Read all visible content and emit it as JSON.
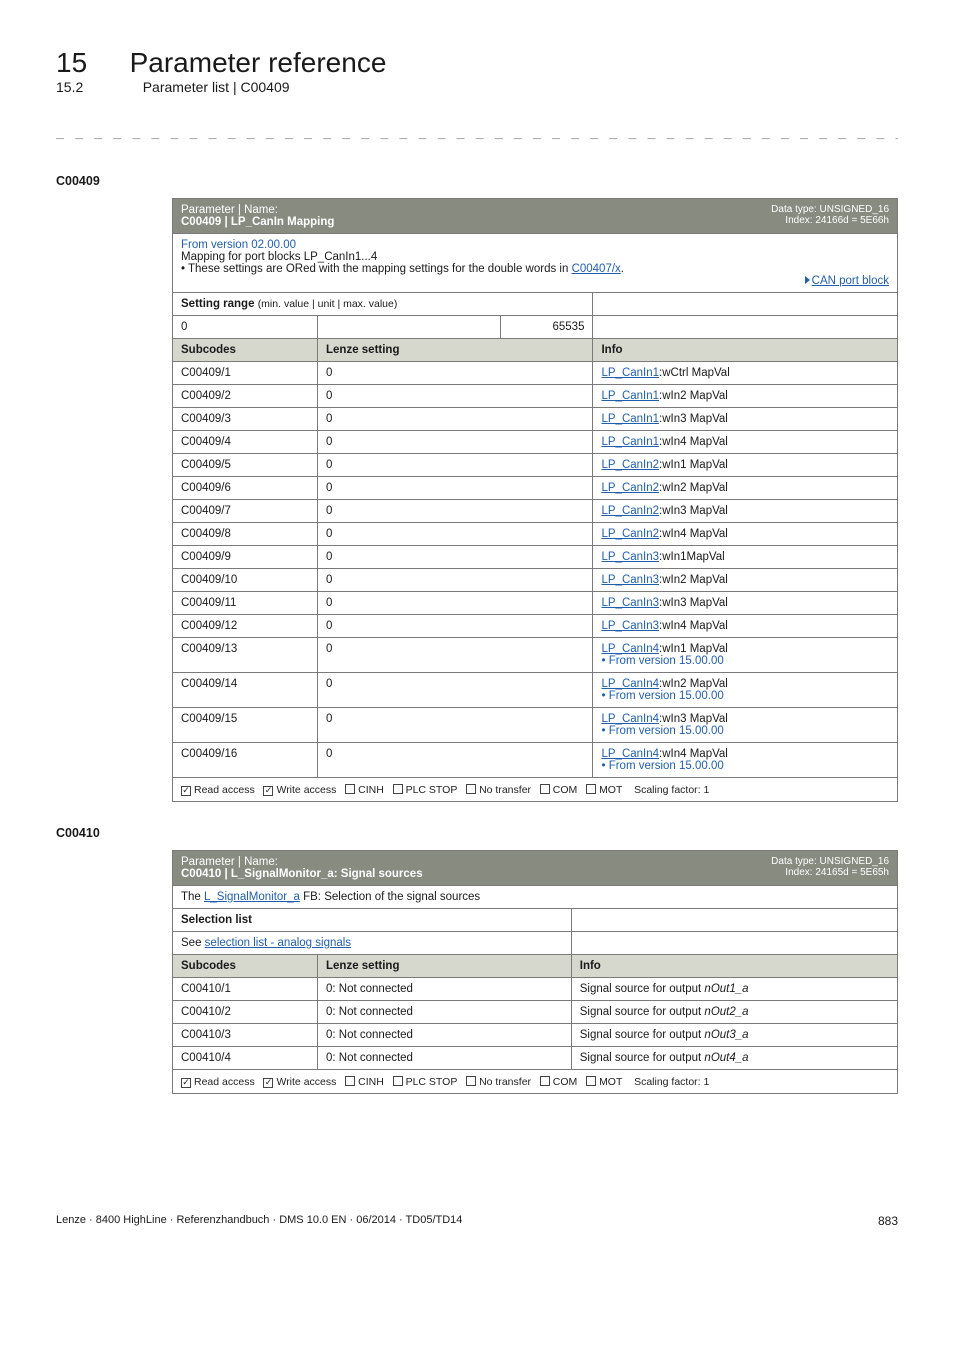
{
  "chapter": {
    "num": "15",
    "title": "Parameter reference",
    "sub_num": "15.2",
    "sub_title": "Parameter list | C00409"
  },
  "dash_sep": "_ _ _ _ _ _ _ _ _ _ _ _ _ _ _ _ _ _ _ _ _ _ _ _ _ _ _ _ _ _ _ _ _ _ _ _ _ _ _ _ _ _ _ _ _ _ _ _ _ _ _ _ _ _ _ _ _ _ _ _ _ _ _ _",
  "c00409": {
    "heading": "C00409",
    "header": {
      "pn_label": "Parameter | Name:",
      "title": "C00409 | LP_CanIn Mapping",
      "dt": "Data type: UNSIGNED_16",
      "idx": "Index: 24166d = 5E66h"
    },
    "blue_block": {
      "from": "From version 02.00.00",
      "map": "Mapping for port blocks LP_CanIn1...4",
      "bullet_pre": " • These settings are ORed with the mapping settings for the double words in ",
      "bullet_link": "C00407/x",
      "bullet_post": ".",
      "can_port": "CAN port block"
    },
    "setting_range": {
      "label": "Setting range",
      "sub": "(min. value | unit | max. value)",
      "min": "0",
      "max": "65535"
    },
    "cols": {
      "subcodes": "Subcodes",
      "lenze": "Lenze setting",
      "info": "Info"
    },
    "rows": [
      {
        "sub": "C00409/1",
        "val": "0",
        "pre": "LP_CanIn1",
        "tail": ":wCtrl MapVal"
      },
      {
        "sub": "C00409/2",
        "val": "0",
        "pre": "LP_CanIn1",
        "tail": ":wIn2 MapVal"
      },
      {
        "sub": "C00409/3",
        "val": "0",
        "pre": "LP_CanIn1",
        "tail": ":wIn3 MapVal"
      },
      {
        "sub": "C00409/4",
        "val": "0",
        "pre": "LP_CanIn1",
        "tail": ":wIn4 MapVal"
      },
      {
        "sub": "C00409/5",
        "val": "0",
        "pre": "LP_CanIn2",
        "tail": ":wIn1 MapVal"
      },
      {
        "sub": "C00409/6",
        "val": "0",
        "pre": "LP_CanIn2",
        "tail": ":wIn2 MapVal"
      },
      {
        "sub": "C00409/7",
        "val": "0",
        "pre": "LP_CanIn2",
        "tail": ":wIn3 MapVal"
      },
      {
        "sub": "C00409/8",
        "val": "0",
        "pre": "LP_CanIn2",
        "tail": ":wIn4 MapVal"
      },
      {
        "sub": "C00409/9",
        "val": "0",
        "pre": "LP_CanIn3",
        "tail": ":wIn1MapVal"
      },
      {
        "sub": "C00409/10",
        "val": "0",
        "pre": "LP_CanIn3",
        "tail": ":wIn2 MapVal"
      },
      {
        "sub": "C00409/11",
        "val": "0",
        "pre": "LP_CanIn3",
        "tail": ":wIn3 MapVal"
      },
      {
        "sub": "C00409/12",
        "val": "0",
        "pre": "LP_CanIn3",
        "tail": ":wIn4 MapVal"
      },
      {
        "sub": "C00409/13",
        "val": "0",
        "pre": "LP_CanIn4",
        "tail": ":wIn1 MapVal",
        "extra": " • From version 15.00.00"
      },
      {
        "sub": "C00409/14",
        "val": "0",
        "pre": "LP_CanIn4",
        "tail": ":wIn2 MapVal",
        "extra": " • From version 15.00.00"
      },
      {
        "sub": "C00409/15",
        "val": "0",
        "pre": "LP_CanIn4",
        "tail": ":wIn3 MapVal",
        "extra": " • From version 15.00.00"
      },
      {
        "sub": "C00409/16",
        "val": "0",
        "pre": "LP_CanIn4",
        "tail": ":wIn4 MapVal",
        "extra": " • From version 15.00.00"
      }
    ],
    "footer": {
      "read": "Read access",
      "write": "Write access",
      "cinh": "CINH",
      "plc": "PLC STOP",
      "notr": "No transfer",
      "com": "COM",
      "mot": "MOT",
      "scale": "Scaling factor: 1"
    }
  },
  "c00410": {
    "heading": "C00410",
    "header": {
      "pn_label": "Parameter | Name:",
      "title": "C00410 | L_SignalMonitor_a: Signal sources",
      "dt": "Data type: UNSIGNED_16",
      "idx": "Index: 24165d = 5E65h"
    },
    "line1_pre": "The ",
    "line1_link": "L_SignalMonitor_a",
    "line1_post": " FB: Selection of the signal sources",
    "sel_list": "Selection list",
    "see_pre": "See ",
    "see_link": "selection list - analog signals",
    "cols": {
      "subcodes": "Subcodes",
      "lenze": "Lenze setting",
      "info": "Info"
    },
    "rows": [
      {
        "sub": "C00410/1",
        "val": "0: Not connected",
        "info": "Signal source for output nOut1_a"
      },
      {
        "sub": "C00410/2",
        "val": "0: Not connected",
        "info": "Signal source for output nOut2_a"
      },
      {
        "sub": "C00410/3",
        "val": "0: Not connected",
        "info": "Signal source for output nOut3_a"
      },
      {
        "sub": "C00410/4",
        "val": "0: Not connected",
        "info": "Signal source for output nOut4_a"
      }
    ],
    "footer": {
      "read": "Read access",
      "write": "Write access",
      "cinh": "CINH",
      "plc": "PLC STOP",
      "notr": "No transfer",
      "com": "COM",
      "mot": "MOT",
      "scale": "Scaling factor: 1"
    }
  },
  "page_footer": {
    "left": "Lenze · 8400 HighLine · Referenzhandbuch · DMS 10.0 EN · 06/2014 · TD05/TD14",
    "right": "883"
  }
}
